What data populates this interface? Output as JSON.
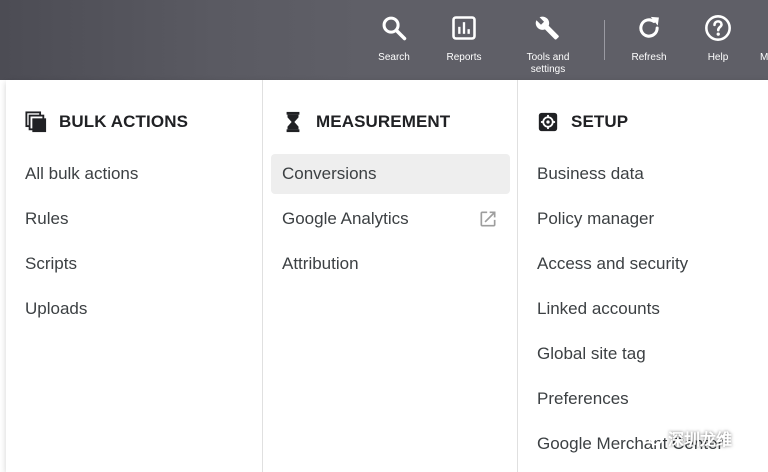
{
  "toolbar": {
    "search_label": "Search",
    "reports_label": "Reports",
    "tools_label_line1": "Tools and",
    "tools_label_line2": "settings",
    "refresh_label": "Refresh",
    "help_label": "Help",
    "edge_label": "M"
  },
  "bulk_actions": {
    "heading": "BULK ACTIONS",
    "items": [
      "All bulk actions",
      "Rules",
      "Scripts",
      "Uploads"
    ]
  },
  "measurement": {
    "heading": "MEASUREMENT",
    "items": [
      "Conversions",
      "Google Analytics",
      "Attribution"
    ],
    "active_item": "Conversions"
  },
  "setup": {
    "heading": "SETUP",
    "items": [
      "Business data",
      "Policy manager",
      "Access and security",
      "Linked accounts",
      "Global site tag",
      "Preferences",
      "Google Merchant Center"
    ]
  },
  "watermark": {
    "text": "深圳龙维"
  },
  "colors": {
    "toolbar_bg": "#5f5f67",
    "active_bg": "#eeeeee",
    "text": "#3c4043"
  }
}
